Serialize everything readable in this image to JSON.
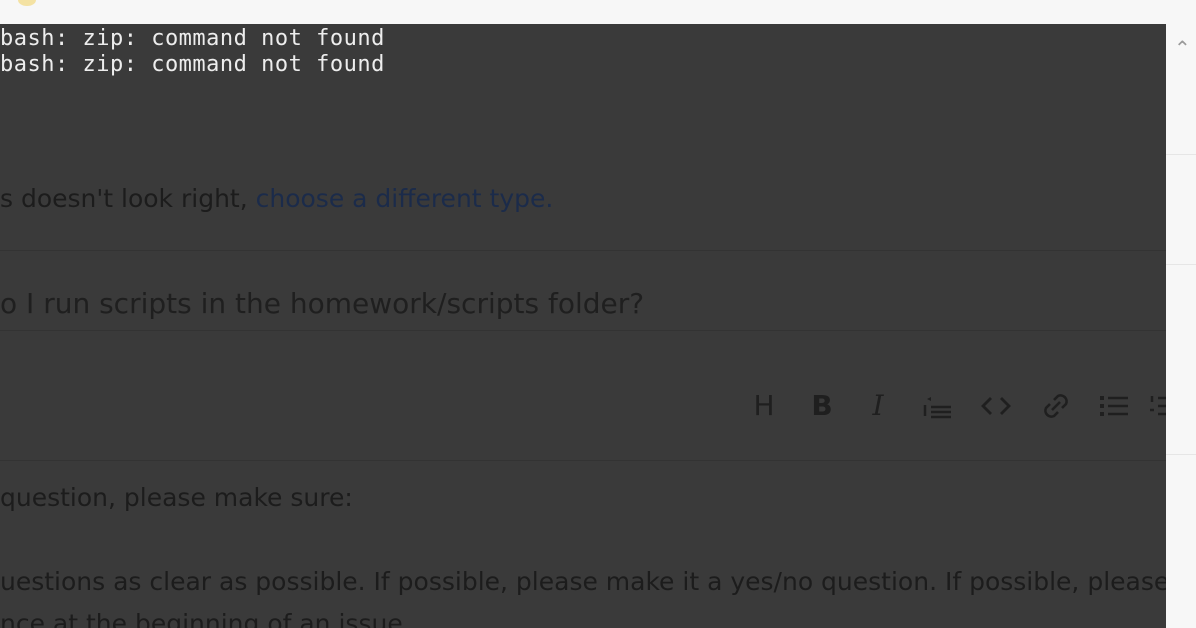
{
  "terminal": {
    "lines": [
      "bash: zip: command not found",
      "bash: zip: command not found"
    ]
  },
  "issue_type_hint": {
    "text": "s doesn't look right, ",
    "link": "choose a different type."
  },
  "title_field": {
    "value": "o I run scripts in the homework/scripts folder?"
  },
  "editor_toolbar": {
    "heading": "H",
    "bold": "B",
    "italic": "I",
    "quote_icon": "quote-icon",
    "code_icon": "code-icon",
    "link_icon": "link-icon",
    "bullet_list_icon": "bulleted-list-icon",
    "numbered_list_icon": "numbered-list-icon"
  },
  "editor_body": {
    "line1": "question, please make sure:",
    "line2": "uestions as clear as possible.  If possible, please make it a yes/no question.  If possible, please sur",
    "line3": "nce at the beginning of an issue"
  }
}
